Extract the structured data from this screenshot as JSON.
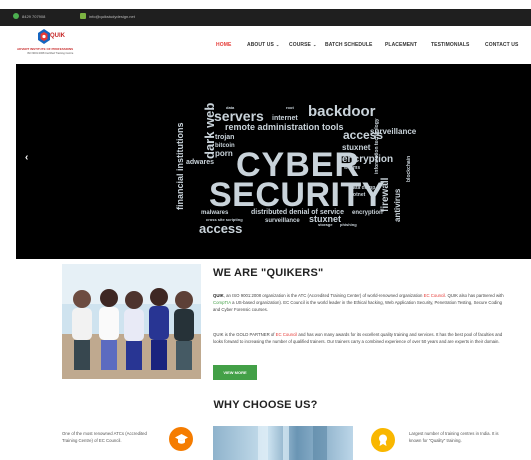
{
  "topbar": {
    "phone": "8429 707908",
    "email": "info@quikstudydesign.net"
  },
  "logo": {
    "brand": "QUIK",
    "tagline": "ADVERT INSTITUTE OF PROFESSIONS",
    "subtag": "ISO 9001:2008 Certified Training Centre"
  },
  "nav": [
    {
      "label": "HOME",
      "dropdown": false,
      "active": true
    },
    {
      "label": "ABOUT US",
      "dropdown": true,
      "active": false
    },
    {
      "label": "COURSE",
      "dropdown": true,
      "active": false
    },
    {
      "label": "BATCH SCHEDULE",
      "dropdown": false,
      "active": false
    },
    {
      "label": "PLACEMENT",
      "dropdown": false,
      "active": false
    },
    {
      "label": "TESTIMONIALS",
      "dropdown": false,
      "active": false
    },
    {
      "label": "CONTACT US",
      "dropdown": false,
      "active": false
    }
  ],
  "hero": {
    "prev": "‹",
    "cloud_main": [
      "CYBER",
      "SECURITY"
    ],
    "cloud_words": [
      "servers",
      "internet",
      "backdoor",
      "remote administration tools",
      "trojan",
      "bitcoin",
      "porn",
      "adwares",
      "dark web",
      "financial institutions",
      "malwares",
      "distributed denial of service",
      "access",
      "surveillance",
      "stuxnet",
      "encryption",
      "root",
      "data",
      "data dump",
      "worms",
      "firewall",
      "antivirus",
      "blockchain",
      "information technology",
      "cross site scripting",
      "storage",
      "hackers",
      "corporations",
      "world wide web",
      "virus",
      "botnet",
      "phishing"
    ]
  },
  "about": {
    "title": "WE ARE \"QUIKERS\"",
    "p1_b": "QUIK",
    "p1_a": ", an ISO 9001:2008 organization is the ATC (Accredited Training Center) of world-renowned organization ",
    "p1_ec": "EC Council",
    "p1_c": ". QUIK also has partnered with ",
    "p1_comptia": "CompTIA",
    "p1_d": " a US-based organization). EC Council is the world leader in the Ethical hacking, Web Application Security, Penetration Testing, Secure Coding and Cyber Forensic courses.",
    "p2_a": "QUIK is the GOLD PARTNER of ",
    "p2_ec": "EC Council",
    "p2_b": " and has won many awards for its excellent quality training and services. It has the best pool of faculties and looks forward to increasing the number of qualified trainers. Our trainers carry a combined experience of over 50 years and are experts in their domain.",
    "button": "VIEW MORE"
  },
  "why": {
    "title": "WHY CHOOSE US?",
    "left_text": "One of the most renowned ATCs (Accredited Training Centre) of EC Council.",
    "right_text": "Largest number of training centres in India. It is known for \"Quality\" training."
  }
}
